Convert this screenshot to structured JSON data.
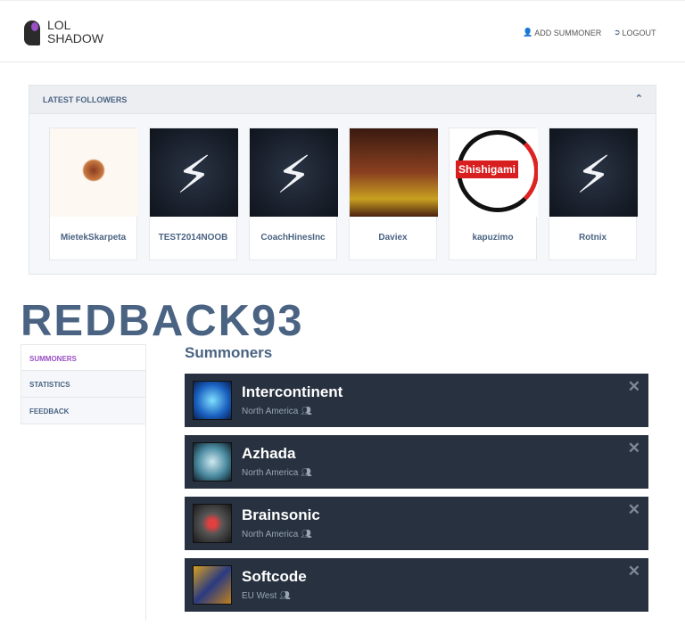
{
  "header": {
    "logo_line1": "LOL",
    "logo_line2": "SHADOW",
    "add_summoner": "ADD SUMMONER",
    "logout": "LOGOUT"
  },
  "followers": {
    "title": "LATEST FOLLOWERS",
    "items": [
      {
        "name": "MietekSkarpeta"
      },
      {
        "name": "TEST2014NOOB"
      },
      {
        "name": "CoachHinesInc"
      },
      {
        "name": "Daviex"
      },
      {
        "name": "kapuzimo",
        "image_text": "Shishigami"
      },
      {
        "name": "Rotnix"
      }
    ]
  },
  "profile": {
    "username": "REDBACK93"
  },
  "sidebar": {
    "items": [
      {
        "label": "SUMMONERS"
      },
      {
        "label": "STATISTICS"
      },
      {
        "label": "FEEDBACK"
      }
    ]
  },
  "summoners": {
    "title": "Summoners",
    "items": [
      {
        "name": "Intercontinent",
        "region": "North America"
      },
      {
        "name": "Azhada",
        "region": "North America"
      },
      {
        "name": "Brainsonic",
        "region": "North America"
      },
      {
        "name": "Softcode",
        "region": "EU West"
      }
    ]
  },
  "colors": {
    "accent": "#9b4fc4",
    "primary": "#4a6382",
    "row_bg": "#27313f"
  }
}
